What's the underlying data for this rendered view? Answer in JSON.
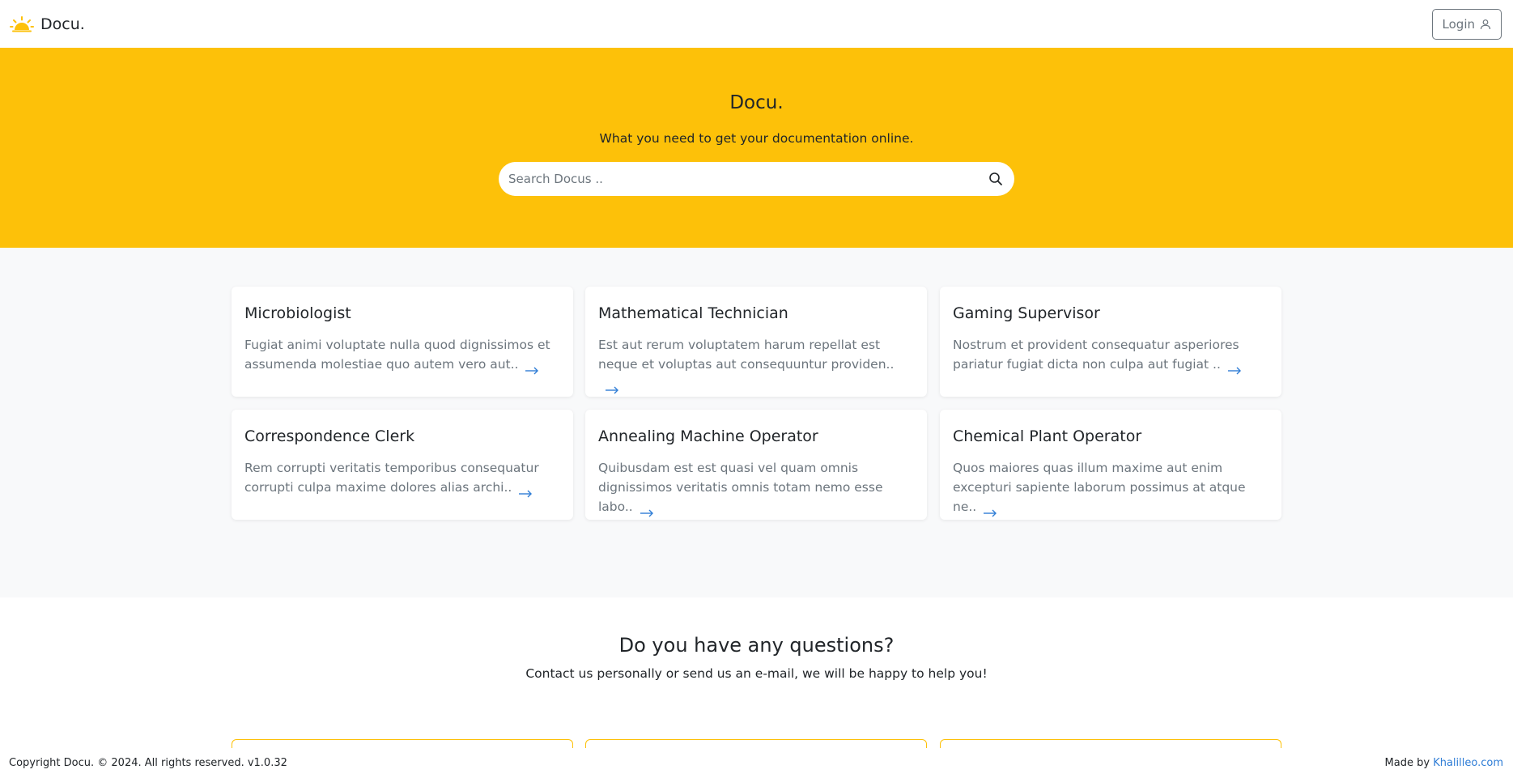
{
  "nav": {
    "brand": "Docu.",
    "login_label": "Login"
  },
  "hero": {
    "title": "Docu.",
    "subtitle": "What you need to get your documentation online.",
    "search_placeholder": "Search Docus .."
  },
  "cards": [
    {
      "title": "Microbiologist",
      "text": "Fugiat animi voluptate nulla quod dignissimos et assumenda molestiae quo autem vero aut.."
    },
    {
      "title": "Mathematical Technician",
      "text": "Est aut rerum voluptatem harum repellat est neque et voluptas aut consequuntur providen.."
    },
    {
      "title": "Gaming Supervisor",
      "text": "Nostrum et provident consequatur asperiores pariatur fugiat dicta non culpa aut fugiat .."
    },
    {
      "title": "Correspondence Clerk",
      "text": "Rem corrupti veritatis temporibus consequatur corrupti culpa maxime dolores alias archi.."
    },
    {
      "title": "Annealing Machine Operator",
      "text": "Quibusdam est est quasi vel quam omnis dignissimos veritatis omnis totam nemo esse labo.."
    },
    {
      "title": "Chemical Plant Operator",
      "text": "Quos maiores quas illum maxime aut enim excepturi sapiente laborum possimus at atque ne.."
    }
  ],
  "questions": {
    "title": "Do you have any questions?",
    "subtitle": "Contact us personally or send us an e-mail, we will be happy to help you!"
  },
  "footer": {
    "copyright": "Copyright Docu. © 2024. All rights reserved. v1.0.32",
    "made_by": "Made by",
    "made_by_link": "Khalilleo.com"
  },
  "colors": {
    "accent": "#fdc109",
    "link": "#2f7dd6",
    "muted": "#6c757d"
  },
  "icons": [
    "sun-logo-icon",
    "user-icon",
    "search-icon",
    "arrow-right-icon"
  ]
}
